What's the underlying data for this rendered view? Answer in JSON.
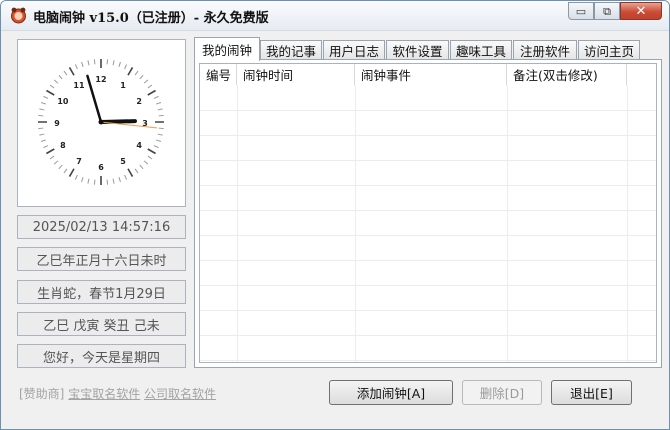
{
  "window": {
    "title": "电脑闹钟 v15.0（已注册）- 永久免费版",
    "controls": {
      "minimize": "▭",
      "restore": "⧉",
      "close": "✕"
    }
  },
  "clock": {
    "numbers": [
      "12",
      "1",
      "2",
      "3",
      "4",
      "5",
      "6",
      "7",
      "8",
      "9",
      "10",
      "11"
    ],
    "hour": 14,
    "minute": 57,
    "second": 16
  },
  "info": {
    "datetime": "2025/02/13 14:57:16",
    "lunar_date": "乙巳年正月十六日未时",
    "zodiac": "生肖蛇，春节1月29日",
    "ganzhi": "乙巳 戊寅 癸丑 己未",
    "greeting": "您好，今天是星期四"
  },
  "tabs": [
    {
      "label": "我的闹钟",
      "active": true
    },
    {
      "label": "我的记事"
    },
    {
      "label": "用户日志"
    },
    {
      "label": "软件设置"
    },
    {
      "label": "趣味工具"
    },
    {
      "label": "注册软件"
    },
    {
      "label": "访问主页"
    }
  ],
  "table": {
    "columns": [
      "编号",
      "闹钟时间",
      "闹钟事件",
      "备注(双击修改)"
    ],
    "rows": []
  },
  "sponsor": {
    "prefix": "[赞助商]",
    "link1": "宝宝取名软件",
    "link2": "公司取名软件"
  },
  "buttons": {
    "add": "添加闹钟[A]",
    "delete": "删除[D]",
    "exit": "退出[E]"
  },
  "colors": {
    "titlebar_top": "#fafbfd",
    "close_red": "#c94d37",
    "second_hand": "#e8a040",
    "minute_hand": "#111111"
  }
}
